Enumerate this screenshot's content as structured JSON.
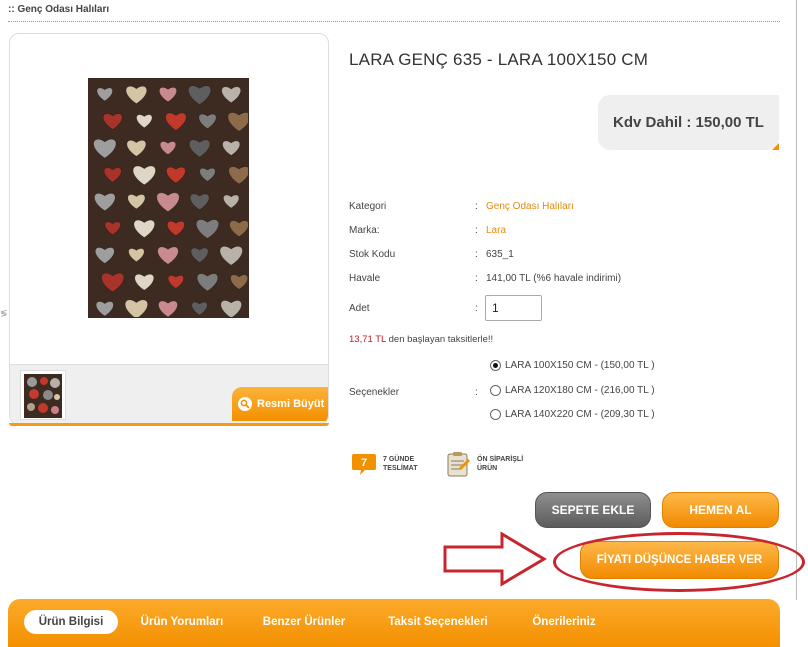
{
  "breadcrumb": ":: Genç Odası Halıları",
  "product": {
    "title": "LARA GENÇ 635 - LARA 100X150 CM",
    "price_label": "Kdv Dahil : 150,00 TL"
  },
  "image_panel": {
    "zoom_label": "Resmi Büyüt"
  },
  "specs": [
    {
      "label": "Kategori",
      "value": "Genç Odası Halıları",
      "link": true
    },
    {
      "label": "Marka:",
      "value": "Lara",
      "link": true
    },
    {
      "label": "Stok Kodu",
      "value": "635_1",
      "link": false
    },
    {
      "label": "Havale",
      "value": "141,00 TL (%6 havale indirimi)",
      "link": false
    }
  ],
  "quantity": {
    "label": "Adet",
    "value": "1"
  },
  "installment": {
    "amount": "13,71 TL",
    "text": " den başlayan taksitlerle!!"
  },
  "options": {
    "label": "Seçenekler",
    "items": [
      {
        "text": "LARA 100X150 CM - (150,00 TL )",
        "selected": true
      },
      {
        "text": "LARA 120X180 CM - (216,00 TL )",
        "selected": false
      },
      {
        "text": "LARA 140X220 CM - (209,30 TL )",
        "selected": false
      }
    ]
  },
  "badges": {
    "delivery": {
      "number": "7",
      "line1": "7 GÜNDE",
      "line2": "TESLİMAT"
    },
    "preorder": {
      "line1": "ÖN SİPARİŞLİ",
      "line2": "ÜRÜN"
    }
  },
  "buttons": {
    "add_to_cart": "SEPETE EKLE",
    "buy_now": "HEMEN AL",
    "price_alert": "FİYATI DÜŞÜNCE HABER VER"
  },
  "tabs": [
    "Ürün Bilgisi",
    "Ürün Yorumları",
    "Benzer Ürünler",
    "Taksit Seçenekleri",
    "Önerileriniz"
  ],
  "colors": {
    "accent": "#f39000",
    "link": "#e8890c",
    "installment": "#c0202a",
    "annotation": "#c8252f"
  }
}
